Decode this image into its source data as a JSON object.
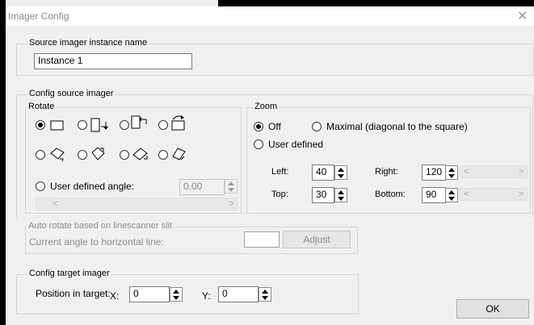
{
  "window": {
    "title": "Imager Config",
    "close_glyph": "✕"
  },
  "source_name": {
    "legend": "Source imager instance name",
    "value": "Instance 1"
  },
  "config_source": {
    "legend": "Config source imager",
    "rotate": {
      "legend": "Rotate",
      "options_row1": [
        "rotate-none-icon",
        "rotate-90-cw-icon",
        "rotate-90-ccw-icon",
        "rotate-180-icon"
      ],
      "options_row2": [
        "rotate-diamond-1-icon",
        "rotate-diamond-2-icon",
        "rotate-diamond-3-icon",
        "rotate-diamond-4-icon"
      ],
      "selected_index": 0,
      "user_defined_label": "User defined angle:",
      "user_defined_value": "0,00"
    },
    "zoom": {
      "legend": "Zoom",
      "off_label": "Off",
      "maximal_label": "Maximal (diagonal to the square)",
      "user_defined_label": "User defined",
      "selected": "off",
      "left_label": "Left:",
      "left_value": "40",
      "right_label": "Right:",
      "right_value": "120",
      "top_label": "Top:",
      "top_value": "30",
      "bottom_label": "Bottom:",
      "bottom_value": "90"
    }
  },
  "auto_rotate": {
    "legend": "Auto rotate based on linescanner slit",
    "angle_label": "Current angle to horizontal line:",
    "angle_value": "",
    "adjust_label": "Adjust"
  },
  "config_target": {
    "legend": "Config target imager",
    "position_label": "Position in target:",
    "x_label": "X:",
    "x_value": "0",
    "y_label": "Y:",
    "y_value": "0"
  },
  "ok_label": "OK"
}
